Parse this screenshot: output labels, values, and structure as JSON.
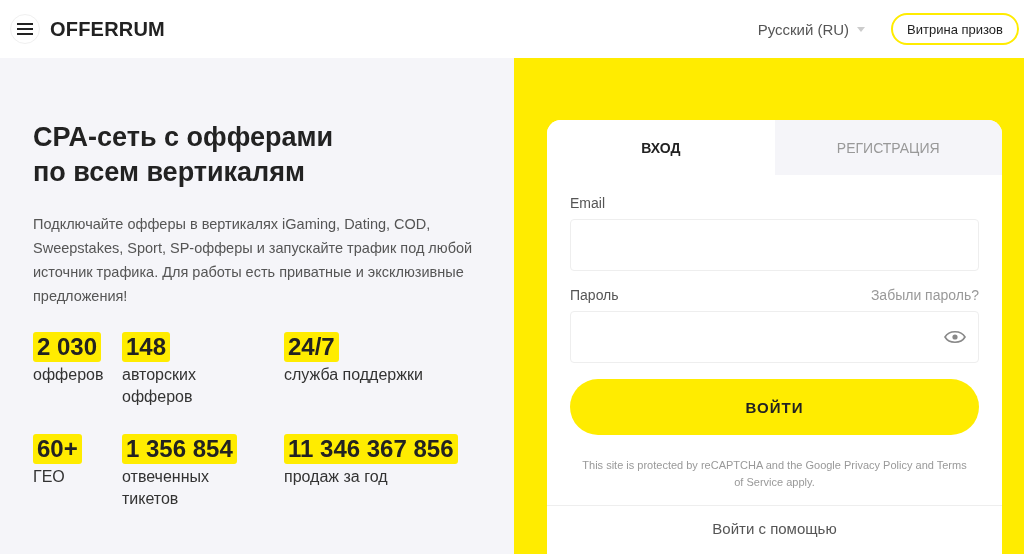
{
  "header": {
    "logo": "OFFERRUM",
    "language": "Русский (RU)",
    "prizes_button": "Витрина призов"
  },
  "hero": {
    "title_lines": [
      "CPA-сеть с офферами",
      "по всем вертикалям"
    ],
    "description": "Подключайте офферы в вертикалях iGaming, Dating, COD, Sweepstakes, Sport, SP-офферы и запускайте трафик под любой источник трафика. Для работы есть приватные и эксклюзивные предложения!"
  },
  "stats": [
    {
      "value": "2 030",
      "label": "офферов"
    },
    {
      "value": "148",
      "label": "авторских офферов"
    },
    {
      "value": "24/7",
      "label": "служба поддержки"
    },
    {
      "value": "60+",
      "label": "ГЕО"
    },
    {
      "value": "1 356 854",
      "label": "отвеченных тикетов"
    },
    {
      "value": "11 346 367 856",
      "label": "продаж за год"
    }
  ],
  "login_card": {
    "tabs": [
      {
        "label": "ВХОД",
        "selected": true
      },
      {
        "label": "РЕГИСТРАЦИЯ",
        "selected": false
      }
    ],
    "email_label": "Email",
    "password_label": "Пароль",
    "forgot_link": "Забыли пароль?",
    "submit_button": "ВОЙТИ",
    "recaptcha_note": "This site is protected by reCAPTCHA and the Google Privacy Policy and Terms of Service apply.",
    "social_login": "Войти с помощью"
  }
}
